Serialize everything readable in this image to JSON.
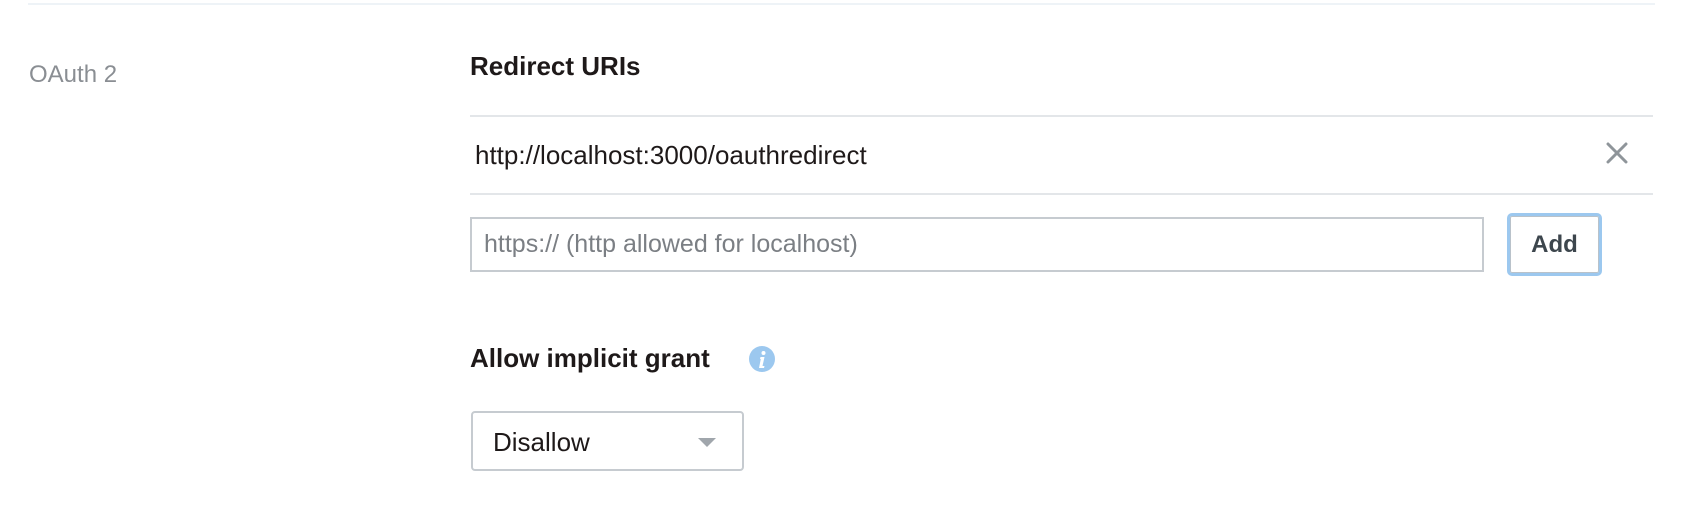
{
  "section": {
    "label": "OAuth 2"
  },
  "redirect_uris": {
    "heading": "Redirect URIs",
    "items": [
      {
        "uri": "http://localhost:3000/oauthredirect",
        "remove_icon": "close-icon"
      }
    ],
    "input_placeholder": "https:// (http allowed for localhost)",
    "input_value": "",
    "add_label": "Add"
  },
  "implicit_grant": {
    "heading": "Allow implicit grant",
    "info_icon": "info-icon",
    "selected": "Disallow"
  },
  "colors": {
    "heading_text": "#1e1919",
    "label_text": "#8a8e93",
    "info_icon": "#9cc8ef",
    "focus_ring": "#9cc8ef"
  }
}
